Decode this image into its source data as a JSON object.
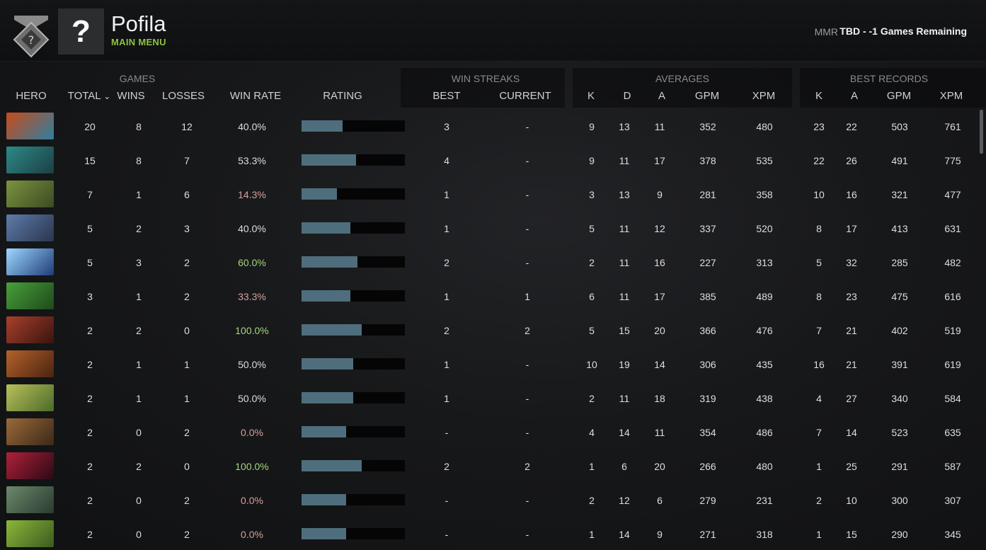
{
  "header": {
    "player_name": "Pofila",
    "main_menu": "MAIN MENU",
    "mmr_label": "MMR",
    "mmr_value": "TBD - -1 Games Remaining",
    "avatar_glyph": "?",
    "rank_icon": "shield-rank-icon",
    "avatar_icon": "question-mark-icon"
  },
  "groups": {
    "games": "GAMES",
    "win_streaks": "WIN STREAKS",
    "averages": "AVERAGES",
    "best_records": "BEST RECORDS"
  },
  "columns": {
    "hero": "HERO",
    "total": "TOTAL",
    "sort_arrow": "⌄",
    "wins": "WINS",
    "losses": "LOSSES",
    "win_rate": "WIN RATE",
    "rating": "RATING",
    "best": "BEST",
    "current": "CURRENT",
    "k": "K",
    "d": "D",
    "a": "A",
    "gpm": "GPM",
    "xpm": "XPM",
    "bk": "K",
    "ba": "A",
    "bgpm": "GPM",
    "bxpm": "XPM"
  },
  "colors": {
    "win_good": "#a4d67c",
    "win_bad": "#d9a0a0",
    "win_neutral": "#dedede",
    "bar": "#4f6e7d",
    "accent": "#8cc43e"
  },
  "rows": [
    {
      "hero_colors": [
        "#c84a1a",
        "#2f7fa0"
      ],
      "total": "20",
      "wins": "8",
      "losses": "12",
      "win_rate": "40.0%",
      "wr_tone": "neutral",
      "rating": 0.4,
      "best": "3",
      "current": "-",
      "k": "9",
      "d": "13",
      "a": "11",
      "gpm": "352",
      "xpm": "480",
      "bk": "23",
      "ba": "22",
      "bgpm": "503",
      "bxpm": "761"
    },
    {
      "hero_colors": [
        "#2d8a86",
        "#1c3f44"
      ],
      "total": "15",
      "wins": "8",
      "losses": "7",
      "win_rate": "53.3%",
      "wr_tone": "neutral",
      "rating": 0.53,
      "best": "4",
      "current": "-",
      "k": "9",
      "d": "11",
      "a": "17",
      "gpm": "378",
      "xpm": "535",
      "bk": "22",
      "ba": "26",
      "bgpm": "491",
      "bxpm": "775"
    },
    {
      "hero_colors": [
        "#7a9440",
        "#3d4a22"
      ],
      "total": "7",
      "wins": "1",
      "losses": "6",
      "win_rate": "14.3%",
      "wr_tone": "bad",
      "rating": 0.34,
      "best": "1",
      "current": "-",
      "k": "3",
      "d": "13",
      "a": "9",
      "gpm": "281",
      "xpm": "358",
      "bk": "10",
      "ba": "16",
      "bgpm": "321",
      "bxpm": "477"
    },
    {
      "hero_colors": [
        "#5e7ca8",
        "#2a3550"
      ],
      "total": "5",
      "wins": "2",
      "losses": "3",
      "win_rate": "40.0%",
      "wr_tone": "neutral",
      "rating": 0.47,
      "best": "1",
      "current": "-",
      "k": "5",
      "d": "11",
      "a": "12",
      "gpm": "337",
      "xpm": "520",
      "bk": "8",
      "ba": "17",
      "bgpm": "413",
      "bxpm": "631"
    },
    {
      "hero_colors": [
        "#9fd8ff",
        "#1e3c78"
      ],
      "total": "5",
      "wins": "3",
      "losses": "2",
      "win_rate": "60.0%",
      "wr_tone": "good",
      "rating": 0.54,
      "best": "2",
      "current": "-",
      "k": "2",
      "d": "11",
      "a": "16",
      "gpm": "227",
      "xpm": "313",
      "bk": "5",
      "ba": "32",
      "bgpm": "285",
      "bxpm": "482"
    },
    {
      "hero_colors": [
        "#48a03a",
        "#1f4a1a"
      ],
      "total": "3",
      "wins": "1",
      "losses": "2",
      "win_rate": "33.3%",
      "wr_tone": "bad",
      "rating": 0.47,
      "best": "1",
      "current": "1",
      "k": "6",
      "d": "11",
      "a": "17",
      "gpm": "385",
      "xpm": "489",
      "bk": "8",
      "ba": "23",
      "bgpm": "475",
      "bxpm": "616"
    },
    {
      "hero_colors": [
        "#a8402a",
        "#3a1410"
      ],
      "total": "2",
      "wins": "2",
      "losses": "0",
      "win_rate": "100.0%",
      "wr_tone": "good",
      "rating": 0.58,
      "best": "2",
      "current": "2",
      "k": "5",
      "d": "15",
      "a": "20",
      "gpm": "366",
      "xpm": "476",
      "bk": "7",
      "ba": "21",
      "bgpm": "402",
      "bxpm": "519"
    },
    {
      "hero_colors": [
        "#b4622a",
        "#4a2410"
      ],
      "total": "2",
      "wins": "1",
      "losses": "1",
      "win_rate": "50.0%",
      "wr_tone": "neutral",
      "rating": 0.5,
      "best": "1",
      "current": "-",
      "k": "10",
      "d": "19",
      "a": "14",
      "gpm": "306",
      "xpm": "435",
      "bk": "16",
      "ba": "21",
      "bgpm": "391",
      "bxpm": "619"
    },
    {
      "hero_colors": [
        "#b8c05a",
        "#4d6a2a"
      ],
      "total": "2",
      "wins": "1",
      "losses": "1",
      "win_rate": "50.0%",
      "wr_tone": "neutral",
      "rating": 0.5,
      "best": "1",
      "current": "-",
      "k": "2",
      "d": "11",
      "a": "18",
      "gpm": "319",
      "xpm": "438",
      "bk": "4",
      "ba": "27",
      "bgpm": "340",
      "bxpm": "584"
    },
    {
      "hero_colors": [
        "#9a6a3a",
        "#3c2818"
      ],
      "total": "2",
      "wins": "0",
      "losses": "2",
      "win_rate": "0.0%",
      "wr_tone": "bad",
      "rating": 0.43,
      "best": "-",
      "current": "-",
      "k": "4",
      "d": "14",
      "a": "11",
      "gpm": "354",
      "xpm": "486",
      "bk": "7",
      "ba": "14",
      "bgpm": "523",
      "bxpm": "635"
    },
    {
      "hero_colors": [
        "#b0203a",
        "#2a0a14"
      ],
      "total": "2",
      "wins": "2",
      "losses": "0",
      "win_rate": "100.0%",
      "wr_tone": "good",
      "rating": 0.58,
      "best": "2",
      "current": "2",
      "k": "1",
      "d": "6",
      "a": "20",
      "gpm": "266",
      "xpm": "480",
      "bk": "1",
      "ba": "25",
      "bgpm": "291",
      "bxpm": "587"
    },
    {
      "hero_colors": [
        "#6a8a6a",
        "#2a3a30"
      ],
      "total": "2",
      "wins": "0",
      "losses": "2",
      "win_rate": "0.0%",
      "wr_tone": "bad",
      "rating": 0.43,
      "best": "-",
      "current": "-",
      "k": "2",
      "d": "12",
      "a": "6",
      "gpm": "279",
      "xpm": "231",
      "bk": "2",
      "ba": "10",
      "bgpm": "300",
      "bxpm": "307"
    },
    {
      "hero_colors": [
        "#8cb83a",
        "#3a5a20"
      ],
      "total": "2",
      "wins": "0",
      "losses": "2",
      "win_rate": "0.0%",
      "wr_tone": "bad",
      "rating": 0.43,
      "best": "-",
      "current": "-",
      "k": "1",
      "d": "14",
      "a": "9",
      "gpm": "271",
      "xpm": "318",
      "bk": "1",
      "ba": "15",
      "bgpm": "290",
      "bxpm": "345"
    }
  ]
}
